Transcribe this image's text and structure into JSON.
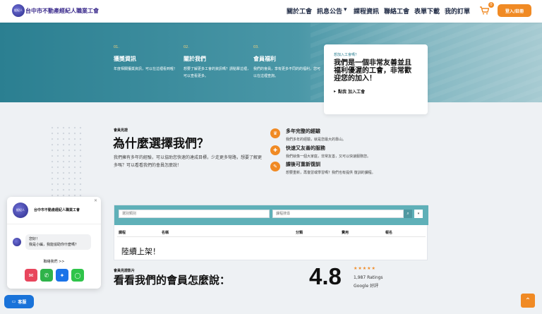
{
  "header": {
    "logo_text": "經紀人",
    "brand": "台中市不動產經紀人職業工會",
    "nav": [
      {
        "label": "關於工會"
      },
      {
        "label": "訊息公告"
      },
      {
        "label": "課程資訊"
      },
      {
        "label": "聯絡工會"
      },
      {
        "label": "表單下載"
      },
      {
        "label": "我的訂單"
      }
    ],
    "cart_count": "0",
    "login_label": "登入/註冊"
  },
  "hero": {
    "features": [
      {
        "num": "01.",
        "title": "獲獎資訊",
        "desc": "年度相關獲獎資訊，可以在這裡看到喔！"
      },
      {
        "num": "02.",
        "title": "關於我們",
        "desc": "想要了解更多工會的資訊嗎？請點擊這裡，可以查看更多。"
      },
      {
        "num": "03.",
        "title": "會員福利",
        "desc": "我們的會員，享有更多不同的的福利，您可以在這裡查詢。"
      }
    ],
    "join": {
      "sub": "想加入工會嗎？",
      "title": "我們是一個非常友善並且福利優渥的工會，非常歡迎您的加入！",
      "link": "點我 加入工會"
    }
  },
  "why": {
    "sub": "會員見證",
    "title": "為什麼選擇我們？",
    "desc": "我們擁有多年的經驗，可以協助您快速的達成目標，少走更多彎路，想要了解更多嗎？可以看看我們的會員怎麼說！",
    "reasons": [
      {
        "icon": "crown-icon",
        "title": "多年完整的經驗",
        "desc": "我們多年的經驗，就是您最大的靠山。"
      },
      {
        "icon": "service-icon",
        "title": "快速又友善的服務",
        "desc": "我們就像一個大家庭，非常友善，又可以快速服務您。"
      },
      {
        "icon": "review-icon",
        "title": "課後可重新復訓",
        "desc": "想要重新，再復習或學習嗎？我們也有提供 復訓的課程。"
      }
    ]
  },
  "search": {
    "category_placeholder": "選別類別",
    "keyword_placeholder": "課程搜尋",
    "columns": [
      "課程",
      "名稱",
      "分類",
      "費用",
      "報名"
    ],
    "empty_message": "陸續上架！"
  },
  "reviews": {
    "sub": "會員見證影片",
    "title": "看看我們的會員怎麼說：",
    "score": "4.8",
    "stars": "★★★★★",
    "ratings": "1,987 Ratings",
    "google": "Google 好評"
  },
  "chat": {
    "avatar_text": "經紀人",
    "name": "台中市不動產經紀人職業工會",
    "greeting_line1": "您好！",
    "greeting_line2": "我是小編，我能協助你什麼嗎？",
    "contact_label": "聯絡我們 >>",
    "cs_label": "客服"
  },
  "colors": {
    "accent": "#f08a24",
    "teal": "#2b7f91",
    "brand": "#3a2a8c"
  }
}
